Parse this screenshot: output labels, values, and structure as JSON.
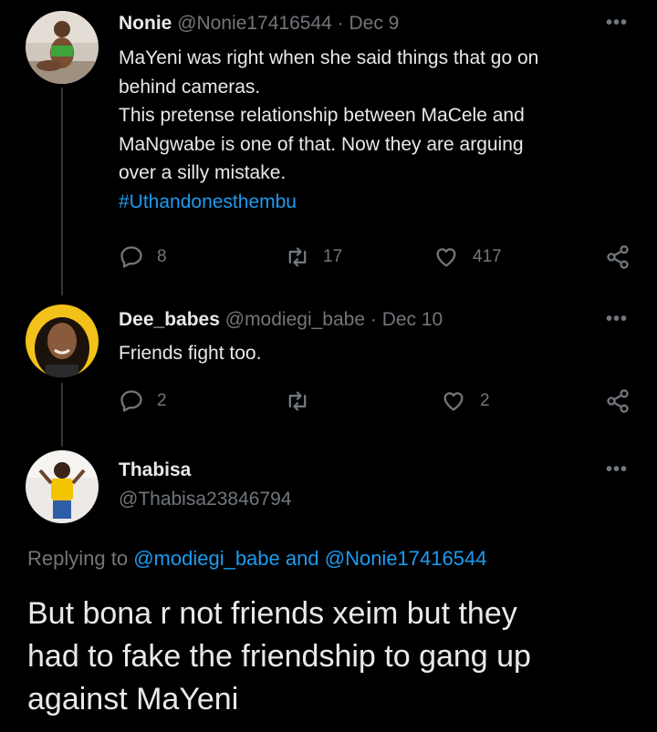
{
  "tweets": [
    {
      "name": "Nonie",
      "handle": "@Nonie17416544",
      "sep": "·",
      "date": "Dec 9",
      "text_lines": [
        "MaYeni was right when she said things that go on",
        "behind cameras.",
        "This pretense relationship between MaCele and",
        "MaNgwabe is one of that. Now they are arguing",
        "over a silly mistake."
      ],
      "hashtag": "#Uthandonesthembu",
      "replies": "8",
      "retweets": "17",
      "likes": "417",
      "more": "•••"
    },
    {
      "name": "Dee_babes",
      "handle": "@modiegi_babe",
      "sep": "·",
      "date": "Dec 10",
      "text": "Friends fight too.",
      "replies": "2",
      "retweets": "",
      "likes": "2",
      "more": "•••"
    }
  ],
  "main_tweet": {
    "name": "Thabisa",
    "handle": "@Thabisa23846794",
    "more": "•••",
    "replying_prefix": "Replying to",
    "replying_user1": "@modiegi_babe",
    "replying_and": "and",
    "replying_user2": "@Nonie17416544",
    "text_lines": [
      "But bona r not friends xeim but they",
      "had to fake the friendship to gang up",
      "against MaYeni"
    ]
  },
  "colors": {
    "background": "#000000",
    "text": "#e7e9ea",
    "muted": "#71767b",
    "accent": "#1d9bf0",
    "thread_line": "#333639"
  },
  "icons": {
    "reply": "reply-icon",
    "retweet": "retweet-icon",
    "like": "heart-icon",
    "share": "share-icon",
    "more": "more-icon"
  }
}
